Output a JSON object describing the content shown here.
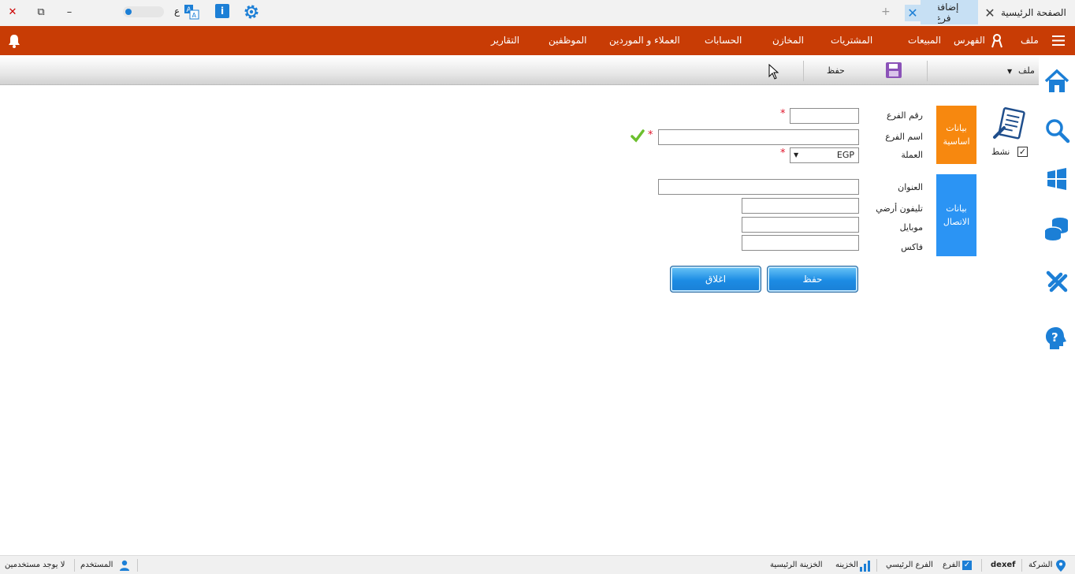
{
  "tabs": {
    "home_label": "الصفحة الرئيسية",
    "active_label": "إضافة فرع",
    "close_glyph": "✕",
    "new_tab_glyph": "+"
  },
  "window": {
    "close": "✕",
    "restore": "⧉",
    "minimize": "–"
  },
  "titlebar": {
    "lang_char": "ع"
  },
  "menu": {
    "items": [
      "ملف",
      "الفهرس",
      "المبيعات",
      "المشتريات",
      "المخازن",
      "الحسابات",
      "العملاء و الموردين",
      "الموظفين",
      "التقارير"
    ]
  },
  "toolbar": {
    "file_label": "ملف",
    "save_label": "حفظ"
  },
  "form": {
    "active_label": "نشط",
    "active_checked": true,
    "section_basic": "بيانات اساسية",
    "section_contact": "بيانات الاتصال",
    "branch_no_label": "رقم الفرع",
    "branch_name_label": "اسم الفرع",
    "currency_label": "العملة",
    "currency_value": "EGP",
    "address_label": "العنوان",
    "landline_label": "تليفون أرضي",
    "mobile_label": "موبايل",
    "fax_label": "فاكس",
    "required_mark": "*",
    "save_button": "حفظ",
    "close_button": "اغلاق"
  },
  "status": {
    "company_label": "الشركة",
    "company_value": "dexef",
    "branch_label": "الفرع",
    "branch_value": "الفرع الرئيسي",
    "treasury_label": "الخزينه",
    "treasury_value": "الخزينة الرئيسية",
    "user_label": "المستخدم",
    "users_value": "لا يوجد مستخدمين"
  },
  "colors": {
    "menu_bg": "#c83c05",
    "basic_section": "#f7880f",
    "contact_section": "#2b94f4",
    "accent_blue": "#1c7fd6"
  }
}
